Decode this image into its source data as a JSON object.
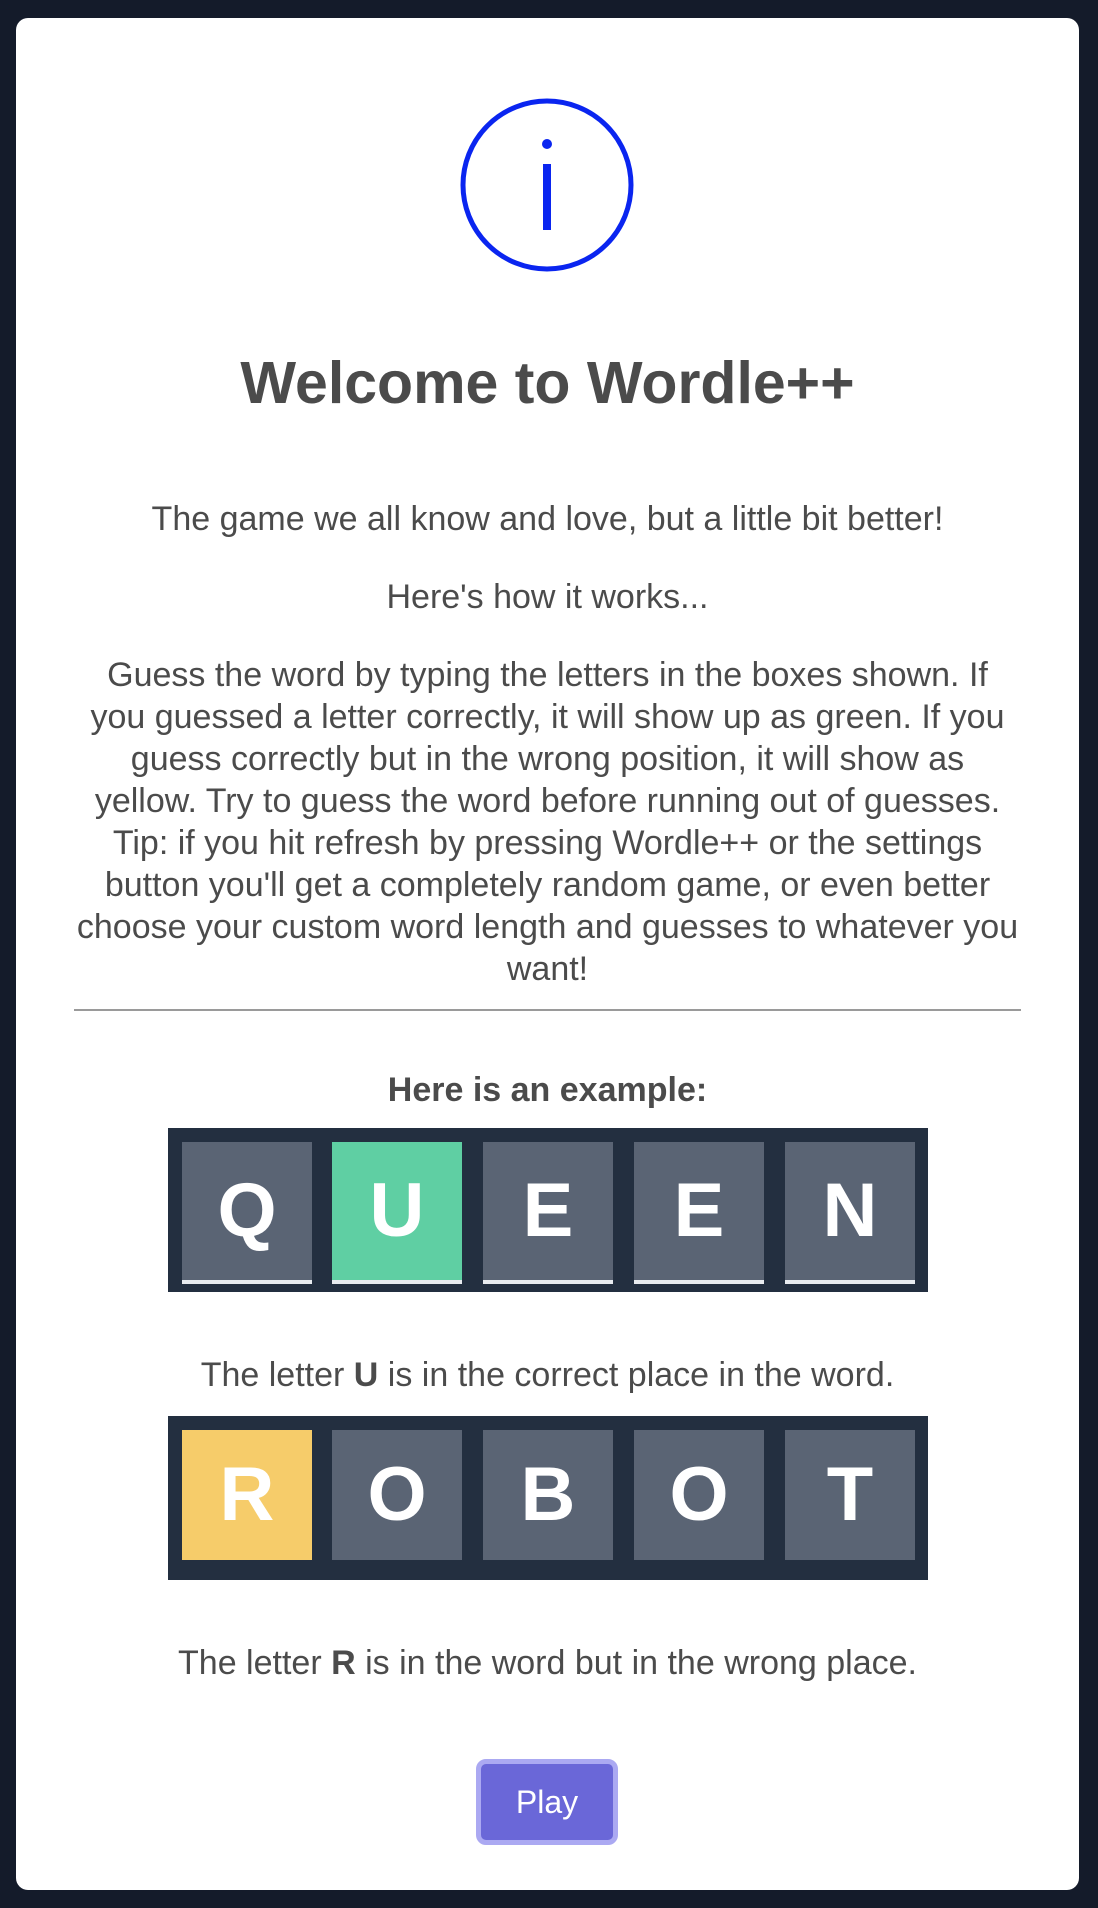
{
  "modal": {
    "icon": "info-icon",
    "title": "Welcome to Wordle++",
    "tagline": "The game we all know and love, but a little bit better!",
    "howto": "Here's how it works...",
    "description": "Guess the word by typing the letters in the boxes shown. If you guessed a letter correctly, it will show up as green. If you guess correctly but in the wrong position, it will show as yellow. Try to guess the word before running out of guesses. Tip: if you hit refresh by pressing Wordle++ or the settings button you'll get a completely random game, or even better choose your custom word length and guesses to whatever you want!",
    "example_label": "Here is an example:",
    "examples": [
      {
        "letters": [
          "Q",
          "U",
          "E",
          "E",
          "N"
        ],
        "states": [
          "absent",
          "correct",
          "absent",
          "absent",
          "absent"
        ],
        "caption_before": "The letter ",
        "caption_letter": "U",
        "caption_after": " is in the correct place in the word."
      },
      {
        "letters": [
          "R",
          "O",
          "B",
          "O",
          "T"
        ],
        "states": [
          "present",
          "absent",
          "absent",
          "absent",
          "absent"
        ],
        "caption_before": "The letter ",
        "caption_letter": "R",
        "caption_after": " is in the word but in the wrong place."
      }
    ],
    "play_label": "Play"
  },
  "colors": {
    "background": "#141b2a",
    "tile_absent": "#5a6474",
    "tile_correct": "#5fcfa3",
    "tile_present": "#f6cc6a",
    "row_bg": "#232f40",
    "icon": "#0a25f0",
    "button": "#6a67d8"
  }
}
